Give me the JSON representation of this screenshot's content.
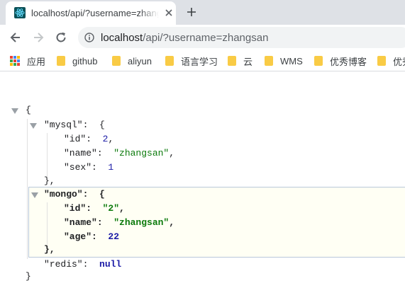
{
  "tab": {
    "title": "localhost/api/?username=zhangsan",
    "favicon": "react-atom-icon"
  },
  "toolbar": {
    "url_host": "localhost",
    "url_path": "/api/?username=zhangsan"
  },
  "bookmarks": [
    {
      "label": "应用",
      "icon": "apps-grid-icon"
    },
    {
      "label": "github",
      "icon": "folder-icon"
    },
    {
      "label": "aliyun",
      "icon": "folder-icon"
    },
    {
      "label": "语言学习",
      "icon": "folder-icon"
    },
    {
      "label": "云",
      "icon": "folder-icon"
    },
    {
      "label": "WMS",
      "icon": "folder-icon"
    },
    {
      "label": "优秀博客",
      "icon": "folder-icon"
    },
    {
      "label": "优秀",
      "icon": "folder-icon"
    }
  ],
  "json": {
    "open_brace": "{",
    "close_brace": "}",
    "mysql": {
      "key": "\"mysql\"",
      "fields": [
        {
          "key": "\"id\"",
          "value": "2",
          "kind": "num",
          "comma": ","
        },
        {
          "key": "\"name\"",
          "value": "\"zhangsan\"",
          "kind": "str",
          "comma": ","
        },
        {
          "key": "\"sex\"",
          "value": "1",
          "kind": "num",
          "comma": ""
        }
      ]
    },
    "mongo": {
      "key": "\"mongo\"",
      "fields": [
        {
          "key": "\"id\"",
          "value": "\"2\"",
          "kind": "str",
          "comma": ","
        },
        {
          "key": "\"name\"",
          "value": "\"zhangsan\"",
          "kind": "str",
          "comma": ","
        },
        {
          "key": "\"age\"",
          "value": "22",
          "kind": "num",
          "comma": ""
        }
      ]
    },
    "redis": {
      "key": "\"redis\"",
      "value": "null"
    }
  },
  "colors": {
    "tab_strip": "#dee1e6",
    "folder": "#f9cb45",
    "string": "#0b7a0b",
    "number": "#1a1aa6",
    "highlight_bg": "#fffff4",
    "highlight_border": "#b9c8da"
  }
}
